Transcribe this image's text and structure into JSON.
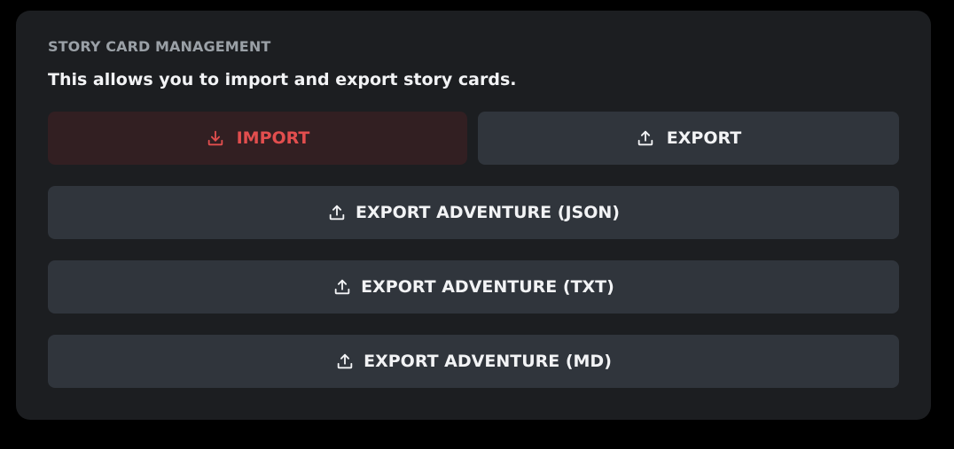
{
  "section": {
    "title": "STORY CARD MANAGEMENT",
    "description": "This allows you to import and export story cards."
  },
  "buttons": {
    "import": {
      "label": "IMPORT",
      "icon": "download-icon",
      "color": "#e24e4e"
    },
    "export": {
      "label": "EXPORT",
      "icon": "upload-icon"
    },
    "export_json": {
      "label": "EXPORT ADVENTURE (JSON)",
      "icon": "upload-icon"
    },
    "export_txt": {
      "label": "EXPORT ADVENTURE (TXT)",
      "icon": "upload-icon"
    },
    "export_md": {
      "label": "EXPORT ADVENTURE (MD)",
      "icon": "upload-icon"
    }
  },
  "colors": {
    "page_background": "#000000",
    "card_background": "#1c1e21",
    "button_background": "#30353c",
    "danger_background": "#321f22",
    "danger_text": "#e24e4e",
    "muted_text": "#9aa0a6",
    "primary_text": "#f2f3f5"
  }
}
